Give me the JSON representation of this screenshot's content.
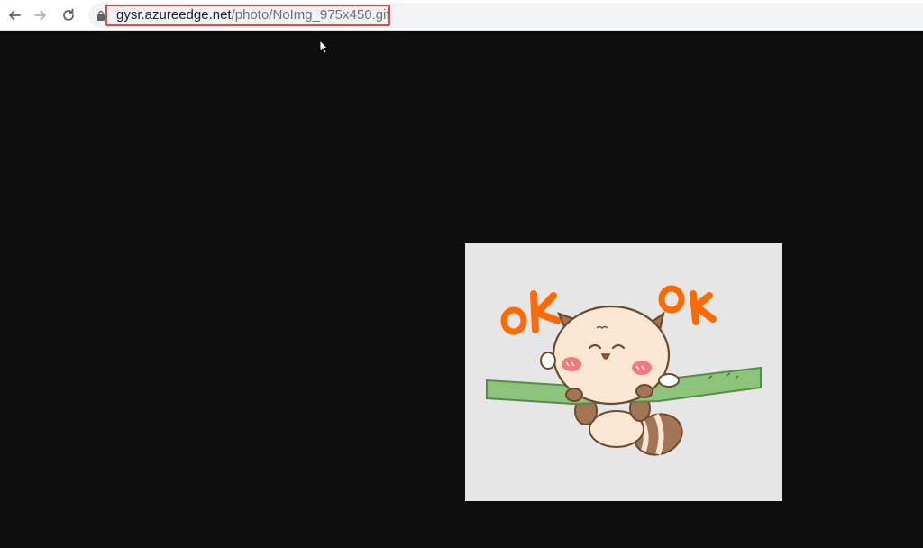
{
  "browser": {
    "nav": {
      "back_icon": "arrow-left-icon",
      "forward_icon": "arrow-right-icon",
      "reload_icon": "reload-icon"
    },
    "address_bar": {
      "lock_icon": "lock-icon",
      "url_host": "gysr.azureedge.net",
      "url_path": "/photo/NoImg_975x450.gif",
      "highlight_color": "#e0474c"
    }
  },
  "content": {
    "background_color": "#0e0e0e",
    "image": {
      "name": "raccoon-cat-ok-sticker",
      "text_left": "OK",
      "text_right": "OK",
      "text_color": "#ff6a00"
    }
  }
}
